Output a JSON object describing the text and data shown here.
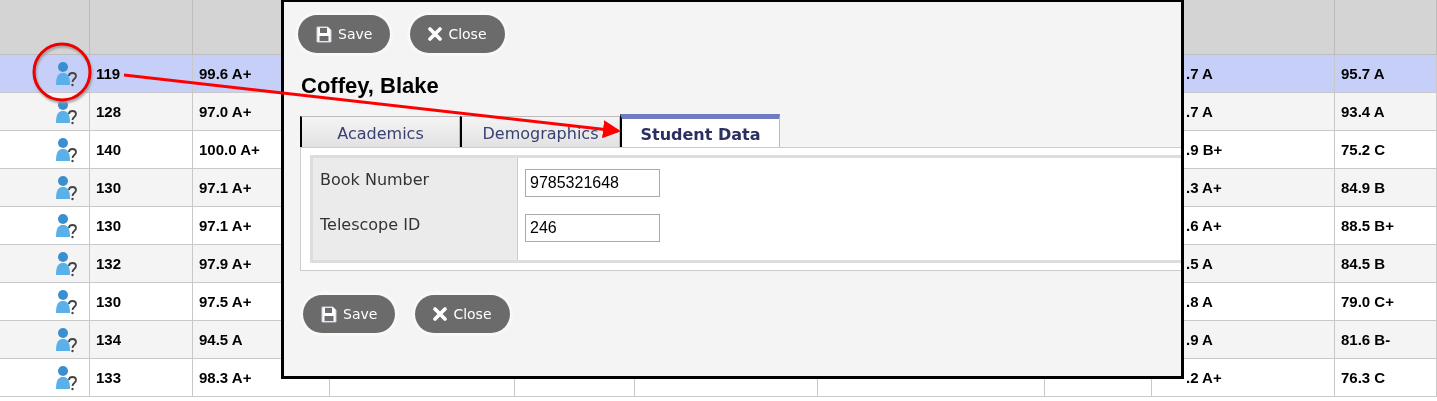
{
  "table": {
    "rows": [
      {
        "selected": true,
        "cells": [
          "119",
          "99.6 A+",
          ".7 A",
          "95.7 A"
        ]
      },
      {
        "selected": false,
        "cells": [
          "128",
          "97.0 A+",
          ".7 A",
          "93.4 A"
        ]
      },
      {
        "selected": false,
        "cells": [
          "140",
          "100.0 A+",
          ".9 B+",
          "75.2 C"
        ]
      },
      {
        "selected": false,
        "cells": [
          "130",
          "97.1 A+",
          ".3 A+",
          "84.9 B"
        ]
      },
      {
        "selected": false,
        "cells": [
          "130",
          "97.1 A+",
          ".6 A+",
          "88.5 B+"
        ]
      },
      {
        "selected": false,
        "cells": [
          "132",
          "97.9 A+",
          ".5 A",
          "84.5 B"
        ]
      },
      {
        "selected": false,
        "cells": [
          "130",
          "97.5 A+",
          ".8 A",
          "79.0 C+"
        ]
      },
      {
        "selected": false,
        "cells": [
          "134",
          "94.5 A",
          ".9 A",
          "81.6 B-"
        ]
      },
      {
        "selected": false,
        "cells": [
          "133",
          "98.3 A+",
          ".2 A+",
          "76.3 C"
        ]
      }
    ]
  },
  "dialog": {
    "top_buttons": [
      {
        "kind": "save",
        "label": "Save"
      },
      {
        "kind": "close",
        "label": "Close"
      }
    ],
    "title": "Coffey, Blake",
    "tabs": [
      {
        "label": "Academics",
        "selected": false
      },
      {
        "label": "Demographics",
        "selected": false
      },
      {
        "label": "Student Data",
        "selected": true
      }
    ],
    "fields": [
      {
        "label": "Book Number",
        "value": "9785321648"
      },
      {
        "label": "Telescope ID",
        "value": "246"
      }
    ],
    "bottom_buttons": [
      {
        "kind": "save",
        "label": "Save"
      },
      {
        "kind": "close",
        "label": "Close"
      }
    ]
  }
}
